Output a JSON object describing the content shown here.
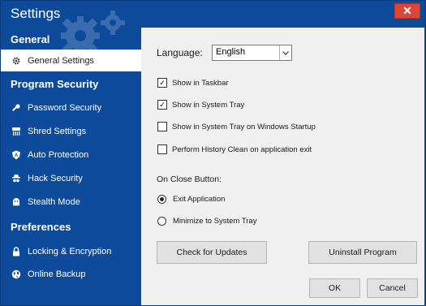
{
  "window": {
    "title": "Settings",
    "close_glyph": "✕"
  },
  "sidebar": {
    "sections": [
      {
        "label": "General",
        "items": [
          {
            "label": "General Settings",
            "icon": "gear-icon",
            "active": true
          }
        ]
      },
      {
        "label": "Program Security",
        "items": [
          {
            "label": "Password Security",
            "icon": "key-icon"
          },
          {
            "label": "Shred Settings",
            "icon": "shredder-icon"
          },
          {
            "label": "Auto Protection",
            "icon": "shield-icon"
          },
          {
            "label": "Hack Security",
            "icon": "spy-icon"
          },
          {
            "label": "Stealth Mode",
            "icon": "ghost-icon"
          }
        ]
      },
      {
        "label": "Preferences",
        "items": [
          {
            "label": "Locking & Encryption",
            "icon": "lock-icon"
          },
          {
            "label": "Online Backup",
            "icon": "globe-icon"
          }
        ]
      }
    ]
  },
  "main": {
    "language_label": "Language:",
    "language_value": "English",
    "checkboxes": [
      {
        "label": "Show in Taskbar",
        "checked": true
      },
      {
        "label": "Show in System Tray",
        "checked": true
      },
      {
        "label": "Show in System Tray on Windows Startup",
        "checked": false
      },
      {
        "label": "Perform History Clean on application exit",
        "checked": false
      }
    ],
    "close_label": "On Close Button:",
    "radios": [
      {
        "label": "Exit Application",
        "selected": true
      },
      {
        "label": "Minimize to System Tray",
        "selected": false
      }
    ],
    "check_updates_label": "Check for Updates",
    "uninstall_label": "Uninstall Program",
    "ok_label": "OK",
    "cancel_label": "Cancel"
  },
  "colors": {
    "sidebar_bg": "#0e4a9a",
    "content_bg": "#f0f0f0",
    "close_bg": "#d9463a"
  }
}
